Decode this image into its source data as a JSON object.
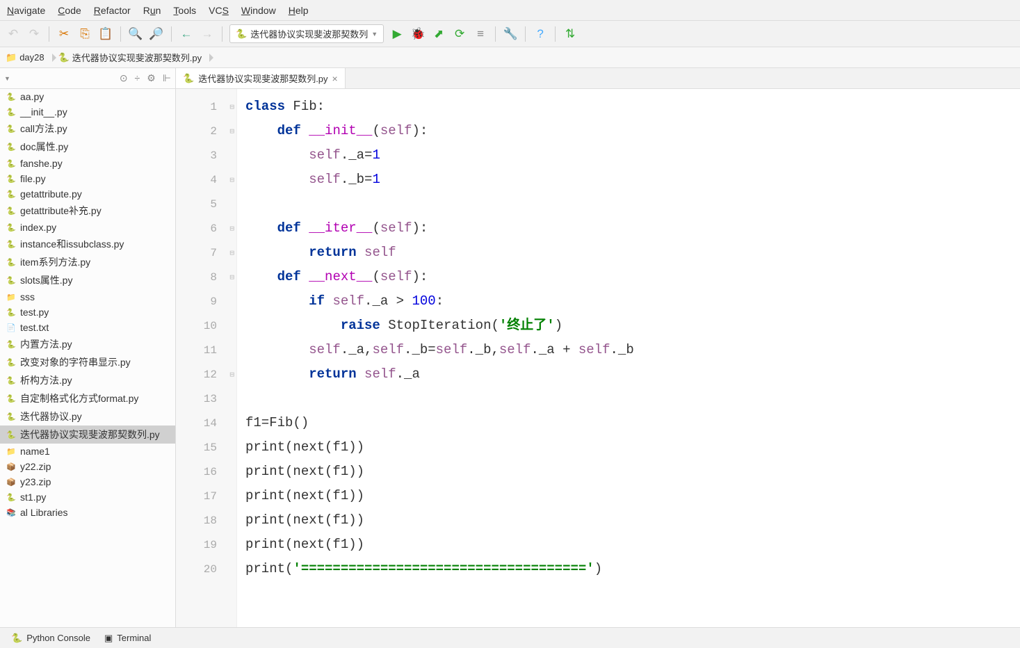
{
  "menu": {
    "items": [
      "Navigate",
      "Code",
      "Refactor",
      "Run",
      "Tools",
      "VCS",
      "Window",
      "Help"
    ],
    "underlines": [
      "N",
      "C",
      "R",
      "u",
      "T",
      "S",
      "W",
      "H"
    ]
  },
  "run_config": "迭代器协议实现斐波那契数列",
  "breadcrumb": {
    "folder": "day28",
    "file": "迭代器协议实现斐波那契数列.py"
  },
  "editor_tab": "迭代器协议实现斐波那契数列.py",
  "files": [
    {
      "name": "aa.py",
      "type": "py"
    },
    {
      "name": "__init__.py",
      "type": "py"
    },
    {
      "name": "call方法.py",
      "type": "py"
    },
    {
      "name": "doc属性.py",
      "type": "py"
    },
    {
      "name": "fanshe.py",
      "type": "py"
    },
    {
      "name": "file.py",
      "type": "py"
    },
    {
      "name": "getattribute.py",
      "type": "py"
    },
    {
      "name": "getattribute补充.py",
      "type": "py"
    },
    {
      "name": "index.py",
      "type": "py"
    },
    {
      "name": "instance和issubclass.py",
      "type": "py"
    },
    {
      "name": "item系列方法.py",
      "type": "py"
    },
    {
      "name": "slots属性.py",
      "type": "py"
    },
    {
      "name": "sss",
      "type": "folder"
    },
    {
      "name": "test.py",
      "type": "py"
    },
    {
      "name": "test.txt",
      "type": "txt"
    },
    {
      "name": "内置方法.py",
      "type": "py"
    },
    {
      "name": "改变对象的字符串显示.py",
      "type": "py"
    },
    {
      "name": "析构方法.py",
      "type": "py"
    },
    {
      "name": "自定制格式化方式format.py",
      "type": "py"
    },
    {
      "name": "迭代器协议.py",
      "type": "py"
    },
    {
      "name": "迭代器协议实现斐波那契数列.py",
      "type": "py",
      "selected": true
    },
    {
      "name": "name1",
      "type": "folder"
    },
    {
      "name": "y22.zip",
      "type": "zip"
    },
    {
      "name": "y23.zip",
      "type": "zip"
    },
    {
      "name": "st1.py",
      "type": "py"
    },
    {
      "name": "al Libraries",
      "type": "lib"
    }
  ],
  "code_lines": [
    {
      "n": 1,
      "fold": true,
      "html": "<span class='kw'>class</span> Fib:"
    },
    {
      "n": 2,
      "fold": true,
      "html": "    <span class='kw'>def</span> <span class='dunder'>__init__</span>(<span class='self'>self</span>):"
    },
    {
      "n": 3,
      "html": "        <span class='self'>self</span>._a=<span class='num'>1</span>"
    },
    {
      "n": 4,
      "fold": true,
      "html": "        <span class='self'>self</span>._b=<span class='num'>1</span>"
    },
    {
      "n": 5,
      "html": ""
    },
    {
      "n": 6,
      "fold": true,
      "html": "    <span class='kw'>def</span> <span class='dunder'>__iter__</span>(<span class='self'>self</span>):"
    },
    {
      "n": 7,
      "fold": true,
      "html": "        <span class='kw'>return</span> <span class='self'>self</span>"
    },
    {
      "n": 8,
      "fold": true,
      "html": "    <span class='kw'>def</span> <span class='dunder'>__next__</span>(<span class='self'>self</span>):"
    },
    {
      "n": 9,
      "html": "        <span class='kw'>if</span> <span class='self'>self</span>._a &gt; <span class='num'>100</span>:"
    },
    {
      "n": 10,
      "html": "            <span class='kw'>raise</span> StopIteration(<span class='str'>'终止了'</span>)"
    },
    {
      "n": 11,
      "html": "        <span class='self'>self</span>._a,<span class='self'>self</span>._b=<span class='self'>self</span>._b,<span class='self'>self</span>._a + <span class='self'>self</span>._b"
    },
    {
      "n": 12,
      "fold": true,
      "html": "        <span class='kw'>return</span> <span class='self'>self</span>._a"
    },
    {
      "n": 13,
      "html": ""
    },
    {
      "n": 14,
      "html": "f1=Fib()"
    },
    {
      "n": 15,
      "html": "print(next(f1))"
    },
    {
      "n": 16,
      "html": "print(next(f1))"
    },
    {
      "n": 17,
      "html": "print(next(f1))"
    },
    {
      "n": 18,
      "html": "print(next(f1))"
    },
    {
      "n": 19,
      "html": "print(next(f1))"
    },
    {
      "n": 20,
      "html": "print(<span class='str'>'===================================='</span>)"
    }
  ],
  "bottom": {
    "console": "Python Console",
    "terminal": "Terminal"
  }
}
